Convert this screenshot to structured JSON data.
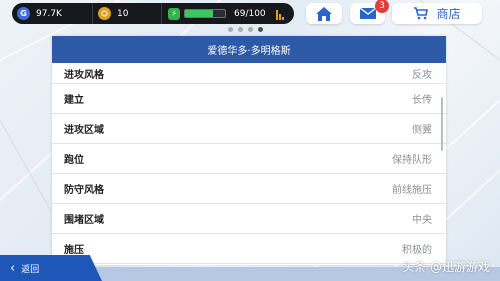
{
  "status_bar": {
    "gold_icon": "G",
    "gold_value": "97.7K",
    "coin_value": "10",
    "energy_value": "69/100",
    "energy_fraction": 0.69
  },
  "top_buttons": {
    "mail_badge": "3",
    "shop_label": "商店"
  },
  "pagination": {
    "count": 4,
    "active_index": 3
  },
  "panel": {
    "title": "爱德华多·多明格斯",
    "rows": [
      {
        "label": "进攻风格",
        "value": "反攻"
      },
      {
        "label": "建立",
        "value": "长传"
      },
      {
        "label": "进攻区域",
        "value": "侧翼"
      },
      {
        "label": "跑位",
        "value": "保持队形"
      },
      {
        "label": "防守风格",
        "value": "前线施压"
      },
      {
        "label": "围堵区域",
        "value": "中央"
      },
      {
        "label": "施压",
        "value": "积极的"
      }
    ]
  },
  "footer": {
    "back_label": "返回",
    "watermark": "头条 @迅游游戏"
  },
  "colors": {
    "header_blue": "#2d5aa6",
    "back_blue": "#1f57b9",
    "badge_red": "#e23c3c",
    "energy_green": "#3fc85a"
  }
}
